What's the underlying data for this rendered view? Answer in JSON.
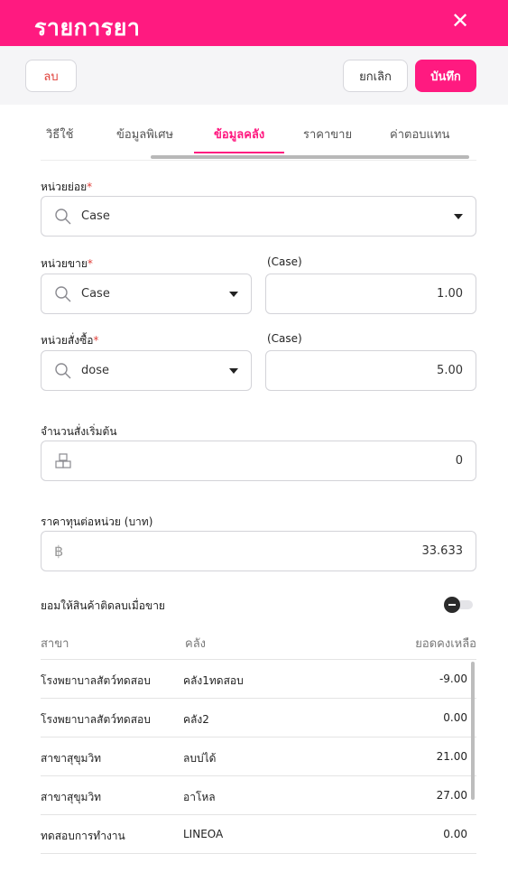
{
  "header": {
    "title": "รายการยา",
    "close_icon": "close-icon"
  },
  "actions": {
    "delete_label": "ลบ",
    "cancel_label": "ยกเลิก",
    "save_label": "บันทึก"
  },
  "tabs": [
    {
      "label": "วิธีใช้"
    },
    {
      "label": "ข้อมูลพิเศษ"
    },
    {
      "label": "ข้อมูลคลัง",
      "active": true
    },
    {
      "label": "ราคาขาย"
    },
    {
      "label": "ค่าตอบแทน"
    }
  ],
  "form": {
    "sub_unit": {
      "label": "หน่วยย่อย",
      "required": "*",
      "value": "Case"
    },
    "sell_unit": {
      "label": "หน่วยขาย",
      "required": "*",
      "value": "Case",
      "qty_label": "(Case)",
      "qty": "1.00"
    },
    "order_unit": {
      "label": "หน่วยสั่งซื้อ",
      "required": "*",
      "value": "dose",
      "qty_label": "(Case)",
      "qty": "5.00"
    },
    "initial_order_qty": {
      "label": "จำนวนสั่งเริ่มต้น",
      "value": "0"
    },
    "cost_per_unit": {
      "label": "ราคาทุนต่อหน่วย (บาท)",
      "value": "33.633",
      "currency_symbol": "฿"
    },
    "allow_negative": {
      "label": "ยอมให้สินค้าติดลบเมื่อขาย",
      "enabled": false
    }
  },
  "stock_table": {
    "headers": [
      "สาขา",
      "คลัง",
      "ยอดคงเหลือ"
    ],
    "rows": [
      [
        "โรงพยาบาลสัตว์ทดสอบ",
        "คลัง1ทดสอบ",
        "-9.00"
      ],
      [
        "โรงพยาบาลสัตว์ทดสอบ",
        "คลัง2",
        "0.00"
      ],
      [
        "สาขาสุขุมวิท",
        "ลบบ่ได้",
        "21.00"
      ],
      [
        "สาขาสุขุมวิท",
        "อาโหล",
        "27.00"
      ],
      [
        "ทดสอบการทำงาน",
        "LINEOA",
        "0.00"
      ]
    ]
  },
  "colors": {
    "brand": "#ff1a80",
    "danger": "#e0403a"
  }
}
